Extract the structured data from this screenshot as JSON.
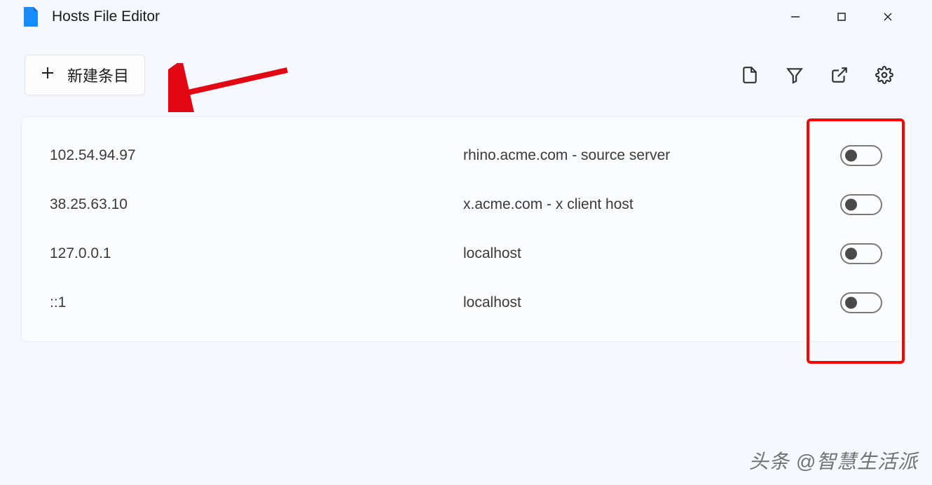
{
  "app": {
    "title": "Hosts File Editor"
  },
  "toolbar": {
    "new_entry_label": "新建条目"
  },
  "entries": [
    {
      "ip": "102.54.94.97",
      "host": "rhino.acme.com - source server",
      "enabled": false
    },
    {
      "ip": "38.25.63.10",
      "host": "x.acme.com - x client host",
      "enabled": false
    },
    {
      "ip": "127.0.0.1",
      "host": "localhost",
      "enabled": false
    },
    {
      "ip": "::1",
      "host": "localhost",
      "enabled": false
    }
  ],
  "watermark": "头条 @智慧生活派"
}
